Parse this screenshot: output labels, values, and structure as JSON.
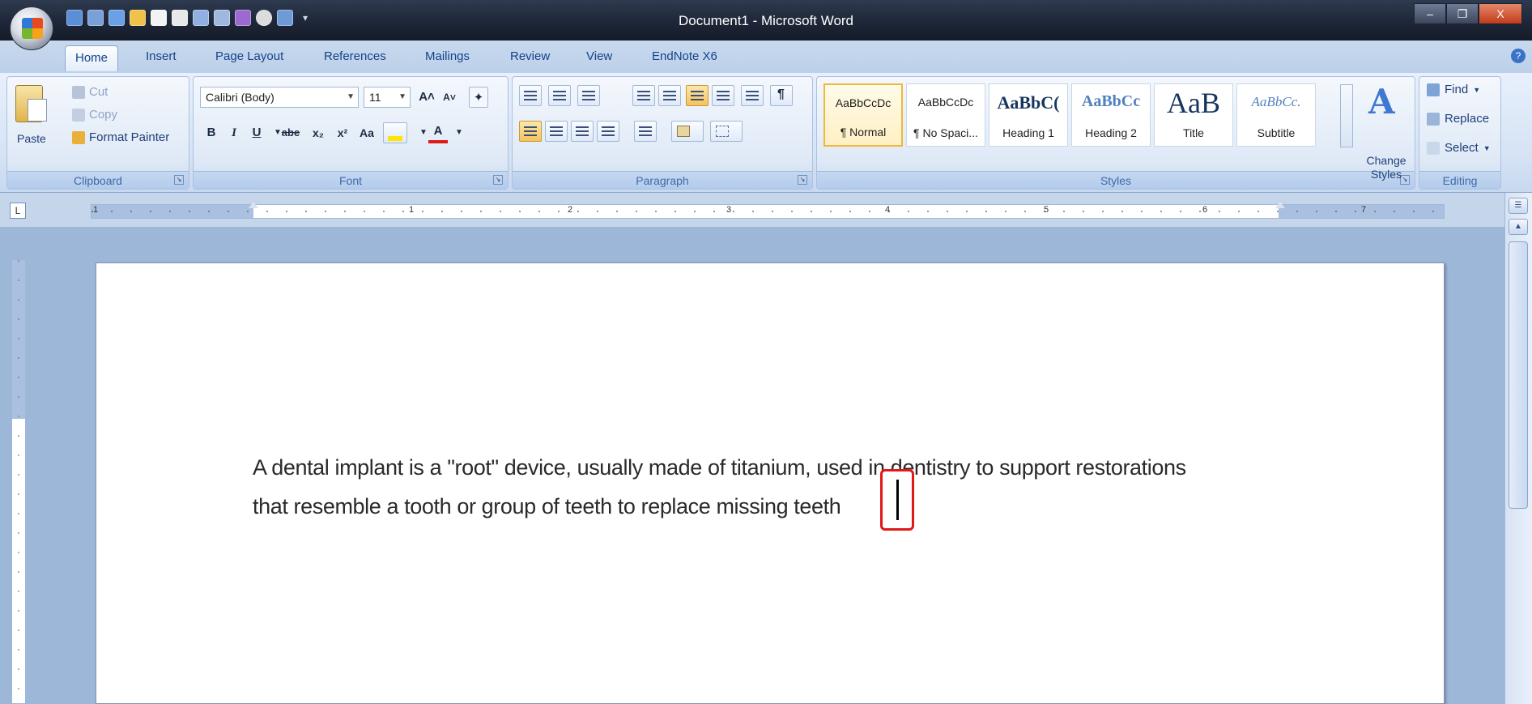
{
  "window": {
    "title": "Document1 - Microsoft Word",
    "minimize": "–",
    "restore": "❐",
    "close": "X"
  },
  "tabs": [
    "Home",
    "Insert",
    "Page Layout",
    "References",
    "Mailings",
    "Review",
    "View",
    "EndNote X6"
  ],
  "active_tab": "Home",
  "clipboard": {
    "label": "Clipboard",
    "paste": "Paste",
    "cut": "Cut",
    "copy": "Copy",
    "format_painter": "Format Painter"
  },
  "font": {
    "label": "Font",
    "family": "Calibri (Body)",
    "size": "11",
    "bold": "B",
    "italic": "I",
    "underline": "U",
    "strikethrough": "abe",
    "subscript": "x₂",
    "superscript": "x²",
    "change_case": "Aa",
    "grow": "A˄",
    "shrink": "A˅",
    "font_color": "A"
  },
  "paragraph": {
    "label": "Paragraph"
  },
  "styles": {
    "label": "Styles",
    "items": [
      {
        "preview": "AaBbCcDc",
        "name": "¶ Normal"
      },
      {
        "preview": "AaBbCcDc",
        "name": "¶ No Spaci..."
      },
      {
        "preview": "AaBbC(",
        "name": "Heading 1"
      },
      {
        "preview": "AaBbCc",
        "name": "Heading 2"
      },
      {
        "preview": "AaB",
        "name": "Title"
      },
      {
        "preview": "AaBbCc.",
        "name": "Subtitle"
      }
    ],
    "change_styles_line1": "Change",
    "change_styles_line2": "Styles"
  },
  "editing": {
    "label": "Editing",
    "find": "Find",
    "replace": "Replace",
    "select": "Select"
  },
  "ruler": {
    "tab_selector": "L",
    "numbers": [
      "1",
      "1",
      "2",
      "3",
      "4",
      "5",
      "6",
      "7"
    ]
  },
  "document": {
    "line1": "A dental implant is a \"root\" device, usually made of titanium, used in dentistry to support restorations",
    "line2": "that resemble a tooth or group of teeth to replace missing teeth"
  },
  "colors": {
    "title_bar": "#1e2738",
    "ribbon": "#d5e3f5",
    "accent": "#15428b",
    "highlight_box": "#e01818"
  }
}
